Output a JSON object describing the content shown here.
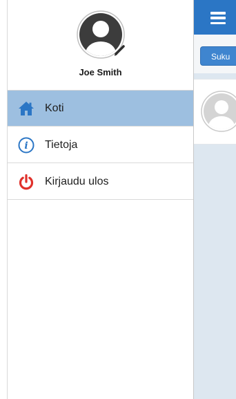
{
  "app": {
    "filter_button_label": "Suku"
  },
  "profile": {
    "name": "Joe Smith"
  },
  "nav": {
    "items": [
      {
        "label": "Koti",
        "icon": "home-icon",
        "selected": true
      },
      {
        "label": "Tietoja",
        "icon": "info-icon",
        "selected": false
      },
      {
        "label": "Kirjaudu ulos",
        "icon": "power-icon",
        "selected": false
      }
    ]
  },
  "colors": {
    "header_blue": "#2b76c5",
    "selected_row": "#9dbfe0",
    "home_icon": "#2b76c5",
    "info_icon": "#2b76c5",
    "power_icon": "#e0312b"
  }
}
